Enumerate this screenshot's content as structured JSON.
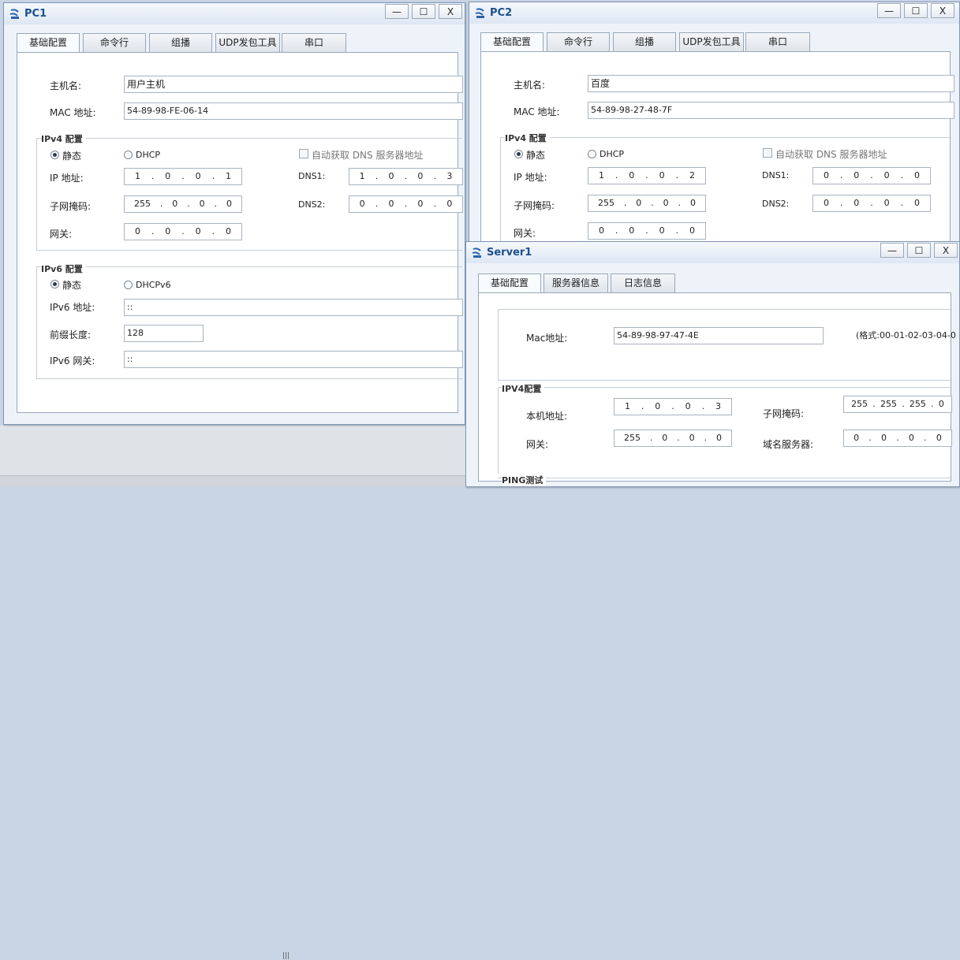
{
  "pc1": {
    "title": "PC1",
    "controls": {
      "minimize": "—",
      "maximize": "☐",
      "close": "X"
    },
    "tabs": [
      "基础配置",
      "命令行",
      "组播",
      "UDP发包工具",
      "串口"
    ],
    "hostname_label": "主机名:",
    "hostname": "用户主机",
    "mac_label": "MAC 地址:",
    "mac": "54-89-98-FE-06-14",
    "ipv4_title": "IPv4 配置",
    "static_label": "静态",
    "dhcp_label": "DHCP",
    "auto_dns_label": "自动获取 DNS 服务器地址",
    "ip_label": "IP 地址:",
    "ip": [
      "1",
      "0",
      "0",
      "1"
    ],
    "dns1_label": "DNS1:",
    "dns1": [
      "1",
      "0",
      "0",
      "3"
    ],
    "mask_label": "子网掩码:",
    "mask": [
      "255",
      "0",
      "0",
      "0"
    ],
    "dns2_label": "DNS2:",
    "dns2": [
      "0",
      "0",
      "0",
      "0"
    ],
    "gw_label": "网关:",
    "gw": [
      "0",
      "0",
      "0",
      "0"
    ],
    "ipv6_title": "IPv6 配置",
    "dhcpv6_label": "DHCPv6",
    "ipv6_label": "IPv6 地址:",
    "ipv6": "::",
    "prefix_label": "前缀长度:",
    "prefix": "128",
    "ipv6gw_label": "IPv6 网关:",
    "ipv6gw": "::"
  },
  "pc2": {
    "title": "PC2",
    "controls": {
      "minimize": "—",
      "maximize": "☐",
      "close": "X"
    },
    "tabs": [
      "基础配置",
      "命令行",
      "组播",
      "UDP发包工具",
      "串口"
    ],
    "hostname_label": "主机名:",
    "hostname": "百度",
    "mac_label": "MAC 地址:",
    "mac": "54-89-98-27-48-7F",
    "ipv4_title": "IPv4 配置",
    "static_label": "静态",
    "dhcp_label": "DHCP",
    "auto_dns_label": "自动获取 DNS 服务器地址",
    "ip_label": "IP 地址:",
    "ip": [
      "1",
      "0",
      "0",
      "2"
    ],
    "dns1_label": "DNS1:",
    "dns1": [
      "0",
      "0",
      "0",
      "0"
    ],
    "mask_label": "子网掩码:",
    "mask": [
      "255",
      "0",
      "0",
      "0"
    ],
    "dns2_label": "DNS2:",
    "dns2": [
      "0",
      "0",
      "0",
      "0"
    ],
    "gw_label": "网关:",
    "gw": [
      "0",
      "0",
      "0",
      "0"
    ]
  },
  "server1": {
    "title": "Server1",
    "controls": {
      "minimize": "—",
      "maximize": "☐",
      "close": "X"
    },
    "tabs": [
      "基础配置",
      "服务器信息",
      "日志信息"
    ],
    "mac_label": "Mac地址:",
    "mac": "54-89-98-97-47-4E",
    "format_hint": "(格式:00-01-02-03-04-0",
    "ipv4_title": "IPV4配置",
    "local_label": "本机地址:",
    "local_ip": [
      "1",
      "0",
      "0",
      "3"
    ],
    "mask_label": "子网掩码:",
    "mask": [
      "255",
      "255",
      "255",
      "0"
    ],
    "gw_label": "网关:",
    "gw": [
      "255",
      "0",
      "0",
      "0"
    ],
    "dns_label": "域名服务器:",
    "dns": [
      "0",
      "0",
      "0",
      "0"
    ],
    "ping_title": "PING测试"
  },
  "colors": {
    "title_text": "#1d4f8c",
    "window_bg": "#eef3fa",
    "border": "#7f96b4"
  },
  "icons": {
    "window": "network-device-icon"
  }
}
